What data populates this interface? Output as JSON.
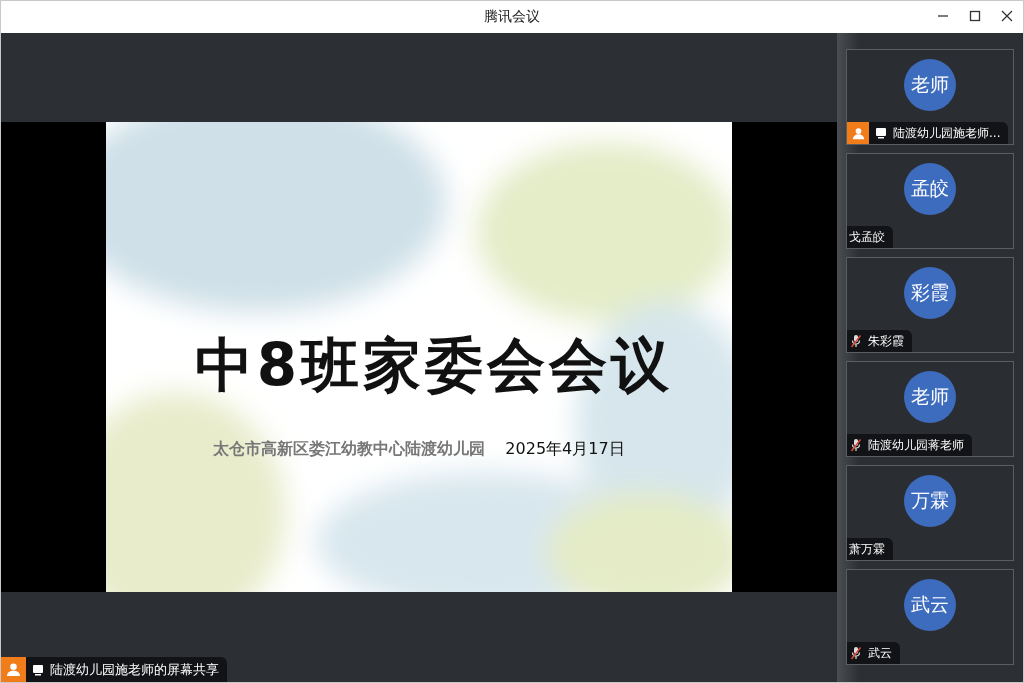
{
  "window": {
    "title": "腾讯会议"
  },
  "slide": {
    "title": "中8班家委会会议",
    "subtitle": "太仓市高新区娄江幼教中心陆渡幼儿园",
    "date": "2025年4月17日"
  },
  "share_label": {
    "text": "陆渡幼儿园施老师的屏幕共享",
    "host": true,
    "sharing": true
  },
  "participants": [
    {
      "avatar": "老师",
      "name": "陆渡幼儿园施老师...",
      "host": true,
      "sharing": true,
      "muted": false
    },
    {
      "avatar": "孟皎",
      "name": "戈孟皎",
      "host": false,
      "sharing": false,
      "muted": false
    },
    {
      "avatar": "彩霞",
      "name": "朱彩霞",
      "host": false,
      "sharing": false,
      "muted": true
    },
    {
      "avatar": "老师",
      "name": "陆渡幼儿园蒋老师",
      "host": false,
      "sharing": false,
      "muted": true
    },
    {
      "avatar": "万霖",
      "name": "萧万霖",
      "host": false,
      "sharing": false,
      "muted": false
    },
    {
      "avatar": "武云",
      "name": "武云",
      "host": false,
      "sharing": false,
      "muted": true
    }
  ]
}
